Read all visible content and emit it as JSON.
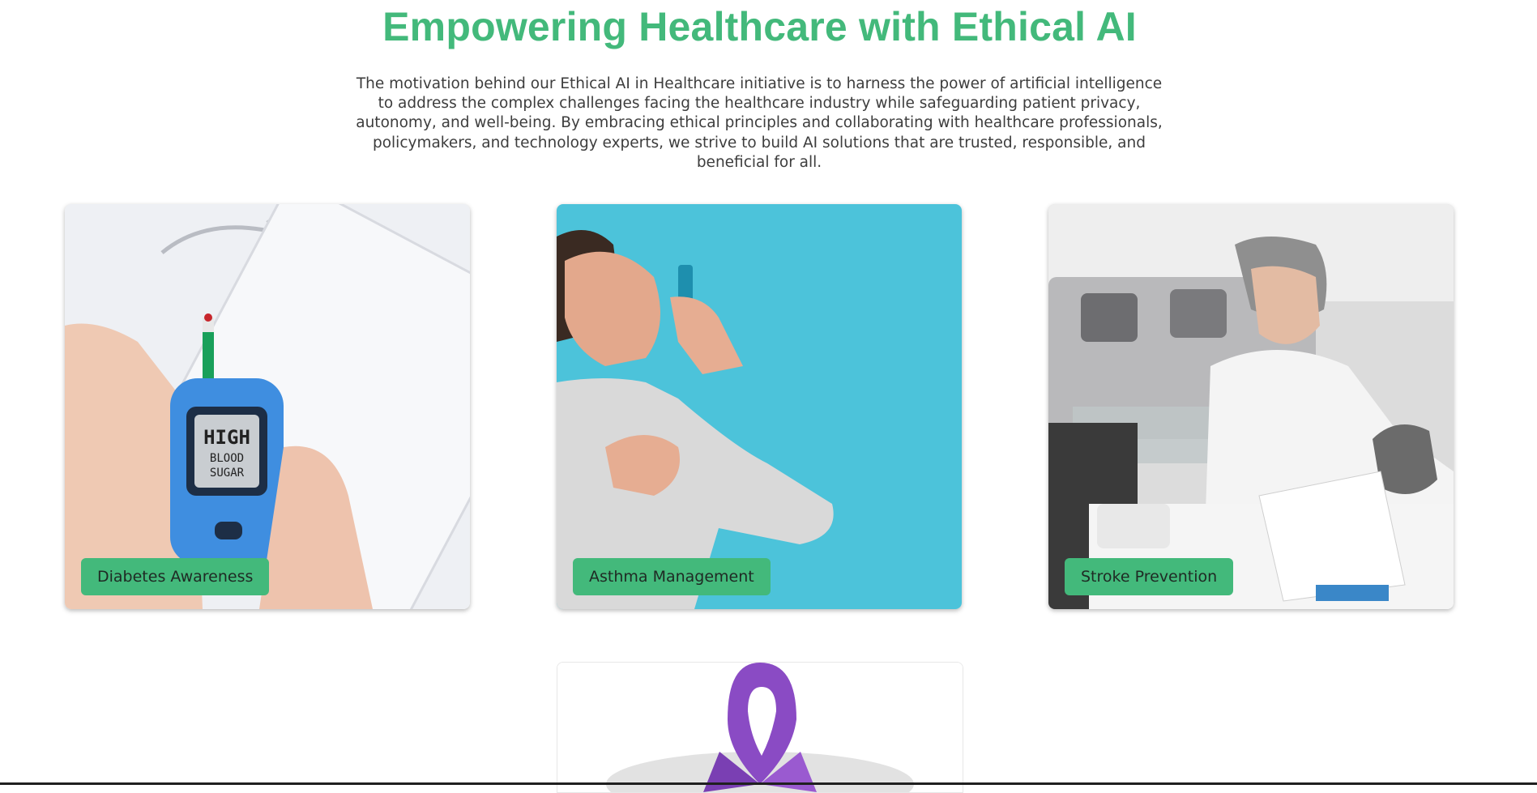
{
  "hero": {
    "title": "Empowering Healthcare with Ethical AI",
    "description": "The motivation behind our Ethical AI in Healthcare initiative is to harness the power of artificial intelligence to address the complex challenges facing the healthcare industry while safeguarding patient privacy, autonomy, and well-being. By embracing ethical principles and collaborating with healthcare professionals, policymakers, and technology experts, we strive to build AI solutions that are trusted, responsible, and beneficial for all."
  },
  "cards": [
    {
      "label": "Diabetes Awareness",
      "meter_text": [
        "HIGH",
        "BLOOD",
        "SUGAR"
      ]
    },
    {
      "label": "Asthma Management"
    },
    {
      "label": "Stroke Prevention"
    },
    {
      "label": ""
    }
  ],
  "colors": {
    "accent": "#43b97b",
    "text": "#3d3d3d",
    "asthma_bg": "#4cc3da",
    "ribbon": "#8a4bc4"
  }
}
